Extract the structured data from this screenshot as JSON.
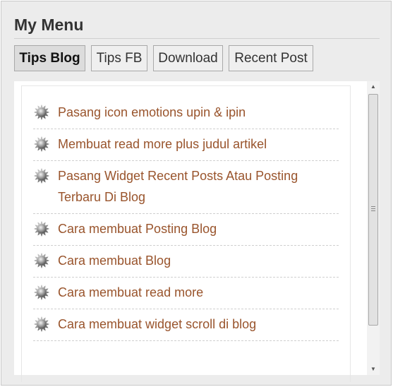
{
  "widget": {
    "title": "My Menu"
  },
  "tabs": [
    {
      "label": "Tips Blog",
      "active": true
    },
    {
      "label": "Tips FB",
      "active": false
    },
    {
      "label": "Download",
      "active": false
    },
    {
      "label": "Recent Post",
      "active": false
    }
  ],
  "posts": [
    {
      "title": "Pasang icon emotions upin & ipin",
      "icon": "gear-bullet-icon"
    },
    {
      "title": "Membuat read more plus judul artikel",
      "icon": "gear-bullet-icon"
    },
    {
      "title": "Pasang Widget Recent Posts Atau Posting Terbaru Di Blog",
      "icon": "gear-bullet-icon"
    },
    {
      "title": "Cara membuat Posting Blog",
      "icon": "gear-bullet-icon"
    },
    {
      "title": "Cara membuat Blog",
      "icon": "gear-bullet-icon"
    },
    {
      "title": "Cara membuat read more",
      "icon": "gear-bullet-icon"
    },
    {
      "title": "Cara membuat widget scroll di blog",
      "icon": "gear-bullet-icon"
    }
  ],
  "scrollbar": {
    "up_icon": "scroll-up-arrow-icon",
    "down_icon": "scroll-down-arrow-icon",
    "position_fraction": 0.0,
    "visible_fraction": 0.82
  },
  "colors": {
    "link": "#99542c",
    "background": "#ececec",
    "active_tab": "#dcdcdc",
    "tab": "#efefef"
  }
}
